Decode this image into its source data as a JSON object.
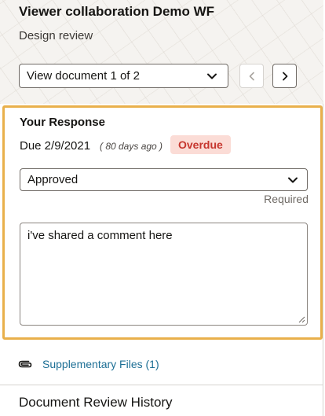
{
  "header": {
    "title": "Viewer collaboration Demo WF",
    "subtitle": "Design review",
    "document_selector": {
      "value": "View document 1 of 2"
    },
    "prev_icon": "chevron-left-icon",
    "next_icon": "chevron-right-icon"
  },
  "response": {
    "heading": "Your Response",
    "due_text": "Due 2/9/2021",
    "days_ago": "( 80 days ago )",
    "status_badge": "Overdue",
    "decision": {
      "value": "Approved",
      "required_label": "Required"
    },
    "comment": {
      "value": "i've shared a comment here"
    }
  },
  "supplementary": {
    "icon": "paperclip-icon",
    "label": "Supplementary Files (1)"
  },
  "history": {
    "label": "Document Review History"
  },
  "colors": {
    "accent_border": "#e9b04b",
    "overdue_bg": "#fbdcd6",
    "overdue_text": "#c6362e",
    "link": "#1d6f95"
  }
}
